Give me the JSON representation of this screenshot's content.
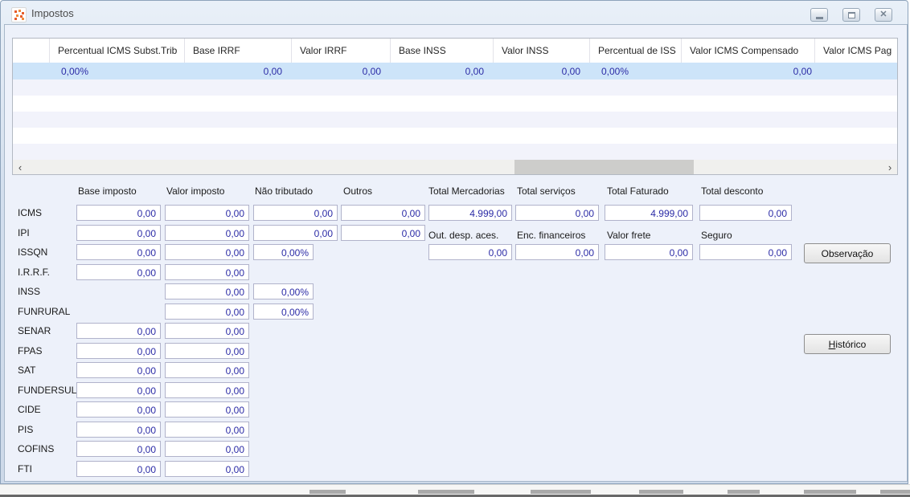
{
  "window": {
    "title": "Impostos",
    "controls": {
      "minimize": "minimize",
      "maximize": "maximize",
      "close": "close",
      "close_glyph": "✕"
    }
  },
  "grid": {
    "columns": [
      "",
      "Percentual ICMS Subst.Trib",
      "Base IRRF",
      "Valor IRRF",
      "Base INSS",
      "Valor INSS",
      "Percentual de ISS",
      "Valor ICMS Compensado",
      "Valor ICMS Pag"
    ],
    "selected_row": {
      "percentual_icms_subst_trib": "0,00%",
      "base_irrf": "0,00",
      "valor_irrf": "0,00",
      "base_inss": "0,00",
      "valor_inss": "0,00",
      "percentual_de_iss": "0,00%",
      "valor_icms_compensado": "0,00"
    },
    "scrollbar": {
      "left_arrow": "‹",
      "right_arrow": "›"
    }
  },
  "form": {
    "headers_row1": {
      "base_imposto": "Base imposto",
      "valor_imposto": "Valor imposto",
      "nao_tributado": "Não tributado",
      "outros": "Outros",
      "total_mercadorias": "Total Mercadorias",
      "total_servicos": "Total serviços",
      "total_faturado": "Total Faturado",
      "total_desconto": "Total desconto"
    },
    "headers_row2": {
      "out_desp_aces": "Out. desp. aces.",
      "enc_financeiros": "Enc. financeiros",
      "valor_frete": "Valor frete",
      "seguro": "Seguro"
    },
    "taxes": [
      {
        "label": "ICMS",
        "base": "0,00",
        "valor": "0,00",
        "nao_tributado": "0,00",
        "outros": "0,00"
      },
      {
        "label": "IPI",
        "base": "0,00",
        "valor": "0,00",
        "nao_tributado": "0,00",
        "outros": "0,00"
      },
      {
        "label": "ISSQN",
        "base": "0,00",
        "valor": "0,00",
        "percent": "0,00%"
      },
      {
        "label": "I.R.R.F.",
        "base": "0,00",
        "valor": "0,00"
      },
      {
        "label": "INSS",
        "valor": "0,00",
        "percent": "0,00%"
      },
      {
        "label": "FUNRURAL",
        "valor": "0,00",
        "percent": "0,00%"
      },
      {
        "label": "SENAR",
        "base": "0,00",
        "valor": "0,00"
      },
      {
        "label": "FPAS",
        "base": "0,00",
        "valor": "0,00"
      },
      {
        "label": "SAT",
        "base": "0,00",
        "valor": "0,00"
      },
      {
        "label": "FUNDERSUL",
        "base": "0,00",
        "valor": "0,00"
      },
      {
        "label": "CIDE",
        "base": "0,00",
        "valor": "0,00"
      },
      {
        "label": "PIS",
        "base": "0,00",
        "valor": "0,00"
      },
      {
        "label": "COFINS",
        "base": "0,00",
        "valor": "0,00"
      },
      {
        "label": "FTI",
        "base": "0,00",
        "valor": "0,00"
      }
    ],
    "totals_line1": {
      "total_mercadorias": "4.999,00",
      "total_servicos": "0,00",
      "total_faturado": "4.999,00",
      "total_desconto": "0,00"
    },
    "totals_line2": {
      "out_desp_aces": "0,00",
      "enc_financeiros": "0,00",
      "valor_frete": "0,00",
      "seguro": "0,00"
    },
    "buttons": {
      "observacao": "Observação",
      "historico": "Histórico"
    }
  }
}
